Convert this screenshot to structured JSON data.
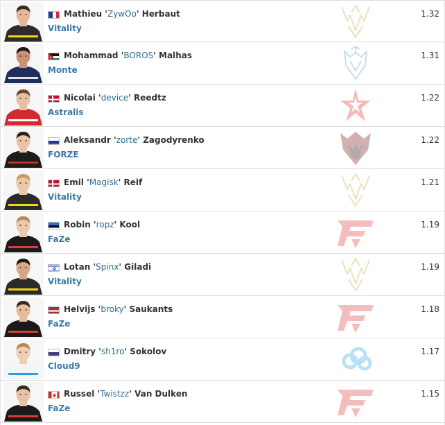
{
  "players": [
    {
      "first": "Mathieu",
      "nick": "ZywOo",
      "last": "Herbaut",
      "team": "Vitality",
      "rating": "1.32",
      "flag": "fr",
      "logo": "vitality-logo-icon",
      "jersey": "#2b2b2b",
      "accent": "#f3d80e",
      "skin": "#e4b899",
      "hair": "#3a2a1e"
    },
    {
      "first": "Mohammad",
      "nick": "BOROS",
      "last": "Malhas",
      "team": "Monte",
      "rating": "1.31",
      "flag": "jo",
      "logo": "monte-logo-icon",
      "jersey": "#1e2f5c",
      "accent": "#e4e4e4",
      "skin": "#c89275",
      "hair": "#241a14"
    },
    {
      "first": "Nicolai",
      "nick": "device",
      "last": "Reedtz",
      "team": "Astralis",
      "rating": "1.22",
      "flag": "dk",
      "logo": "astralis-logo-icon",
      "jersey": "#d12a2f",
      "accent": "#ffffff",
      "skin": "#e7bfa4",
      "hair": "#6b4a2e"
    },
    {
      "first": "Aleksandr",
      "nick": "zorte",
      "last": "Zagodyrenko",
      "team": "FORZE",
      "rating": "1.22",
      "flag": "ru",
      "logo": "forze-logo-icon",
      "jersey": "#1c1c1c",
      "accent": "#c9302c",
      "skin": "#e8c3a8",
      "hair": "#2a221c"
    },
    {
      "first": "Emil",
      "nick": "Magisk",
      "last": "Reif",
      "team": "Vitality",
      "rating": "1.21",
      "flag": "dk",
      "logo": "vitality-logo-icon",
      "jersey": "#2b2b2b",
      "accent": "#f3d80e",
      "skin": "#ecc7a8",
      "hair": "#c79a5a"
    },
    {
      "first": "Robin",
      "nick": "ropz",
      "last": "Kool",
      "team": "FaZe",
      "rating": "1.19",
      "flag": "ee",
      "logo": "faze-logo-icon",
      "jersey": "#1a1a1a",
      "accent": "#e03b3b",
      "skin": "#ecc9ad",
      "hair": "#b88a5e"
    },
    {
      "first": "Lotan",
      "nick": "Spinx",
      "last": "Giladi",
      "team": "Vitality",
      "rating": "1.19",
      "flag": "il",
      "logo": "vitality-logo-icon",
      "jersey": "#2b2b2b",
      "accent": "#f3d80e",
      "skin": "#d6a784",
      "hair": "#1f1712"
    },
    {
      "first": "Helvijs",
      "nick": "broky",
      "last": "Saukants",
      "team": "FaZe",
      "rating": "1.18",
      "flag": "lv",
      "logo": "faze-logo-icon",
      "jersey": "#1a1a1a",
      "accent": "#e03b3b",
      "skin": "#e6bc9c",
      "hair": "#3b2a1e"
    },
    {
      "first": "Dmitry",
      "nick": "sh1ro",
      "last": "Sokolov",
      "team": "Cloud9",
      "rating": "1.17",
      "flag": "ru",
      "logo": "cloud9-logo-icon",
      "jersey": "#f2f4f6",
      "accent": "#2e9fd8",
      "skin": "#efcfb4",
      "hair": "#b58a55"
    },
    {
      "first": "Russel",
      "nick": "Twistzz",
      "last": "Van Dulken",
      "team": "FaZe",
      "rating": "1.15",
      "flag": "ca",
      "logo": "faze-logo-icon",
      "jersey": "#1a1a1a",
      "accent": "#e03b3b",
      "skin": "#e9c2a3",
      "hair": "#3a2a1f"
    }
  ]
}
